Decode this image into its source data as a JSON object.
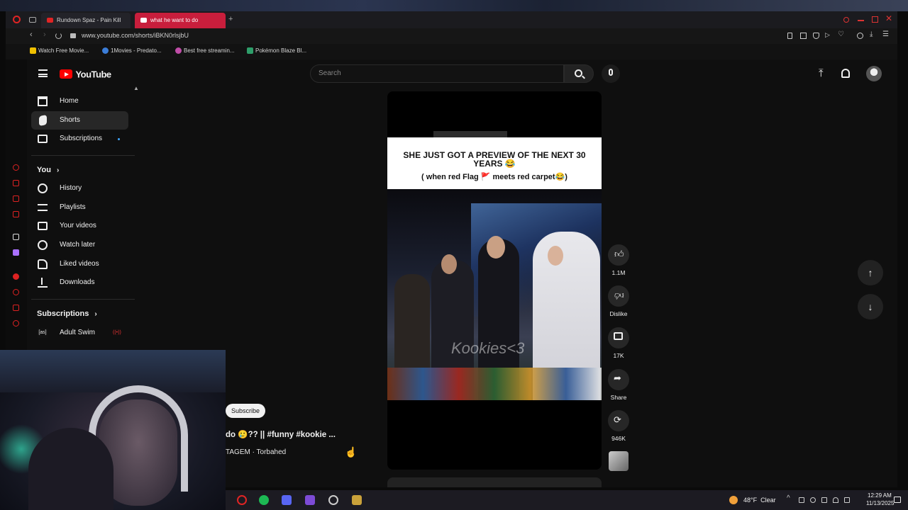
{
  "browser": {
    "tabs": [
      {
        "label": "Rundown Spaz - Pain Kill",
        "active": false
      },
      {
        "label": "what he want to do",
        "active": true
      }
    ],
    "new_tab": "+",
    "url": "www.youtube.com/shorts/iBKN0rlsjbU",
    "bookmarks": [
      {
        "label": "Watch Free Movie...",
        "color": "#f0c000"
      },
      {
        "label": "1Movies - Predato...",
        "color": "#3b7dd8"
      },
      {
        "label": "Best free streamin...",
        "color": "#c04da8"
      },
      {
        "label": "Pokémon Blaze Bl...",
        "color": "#2e9e6a"
      }
    ]
  },
  "youtube": {
    "logo": "YouTube",
    "search_placeholder": "Search",
    "sidebar": {
      "main": [
        {
          "label": "Home",
          "icon": "home-icon"
        },
        {
          "label": "Shorts",
          "icon": "shorts-icon",
          "active": true
        },
        {
          "label": "Subscriptions",
          "icon": "subscriptions-icon"
        }
      ],
      "you_header": "You",
      "you": [
        {
          "label": "History",
          "icon": "history-icon"
        },
        {
          "label": "Playlists",
          "icon": "playlists-icon"
        },
        {
          "label": "Your videos",
          "icon": "your-videos-icon"
        },
        {
          "label": "Watch later",
          "icon": "watch-later-icon"
        },
        {
          "label": "Liked videos",
          "icon": "liked-videos-icon"
        },
        {
          "label": "Downloads",
          "icon": "downloads-icon"
        }
      ],
      "subs_header": "Subscriptions",
      "subs": [
        {
          "label": "Adult Swim",
          "live_badge": "((•))"
        }
      ]
    },
    "short": {
      "caption_line1": "SHE JUST GOT A PREVIEW OF THE NEXT 30 YEARS 😂",
      "caption_line2": "( when red Flag 🚩 meets red carpet😂)",
      "watermark": "Kookies<3",
      "title": "do 🥲?? || #funny #kookie ...",
      "channel": "TAGEM · Torbahed",
      "subscribe": "Subscribe"
    },
    "actions": [
      {
        "label": "1.1M",
        "icon": "like-icon"
      },
      {
        "label": "Dislike",
        "icon": "dislike-icon"
      },
      {
        "label": "17K",
        "icon": "comments-icon"
      },
      {
        "label": "Share",
        "icon": "share-icon"
      },
      {
        "label": "946K",
        "icon": "remix-icon"
      }
    ]
  },
  "taskbar": {
    "weather": "48°F  Clear",
    "time": "12:29 AM",
    "date": "11/13/2025"
  }
}
